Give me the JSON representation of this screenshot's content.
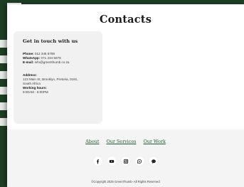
{
  "modal": {
    "title": "Contacts"
  },
  "contact": {
    "heading": "Get in touch with us",
    "phone_label": "Phone:",
    "phone_value": "012 345 6789",
    "whatsapp_label": "WhatsApp:",
    "whatsapp_value": "071 234 5678",
    "email_label": "E-mail:",
    "email_value": "info@greenthumb.co.za",
    "address_label": "Address:",
    "address_line1": "123 Main St, Brooklyn, Pretoria, 0181,",
    "address_line2": "South Africa",
    "hours_label": "Working hours:",
    "hours_value": "9:00AM - 6:00PM"
  },
  "footer": {
    "links": [
      "About",
      "Our Services",
      "Our Work"
    ],
    "socials": [
      {
        "icon": "facebook-icon"
      },
      {
        "icon": "youtube-icon"
      },
      {
        "icon": "instagram-icon"
      },
      {
        "icon": "whatsapp-icon"
      },
      {
        "icon": "chat-icon"
      }
    ],
    "copyright": "©Copyright 2025 GreenThumb- All Rights Reserved"
  },
  "colors": {
    "background": "#1f3f24",
    "link": "#1e5a2c",
    "card": "#f1f1f1",
    "footer": "#f4f4f4"
  }
}
